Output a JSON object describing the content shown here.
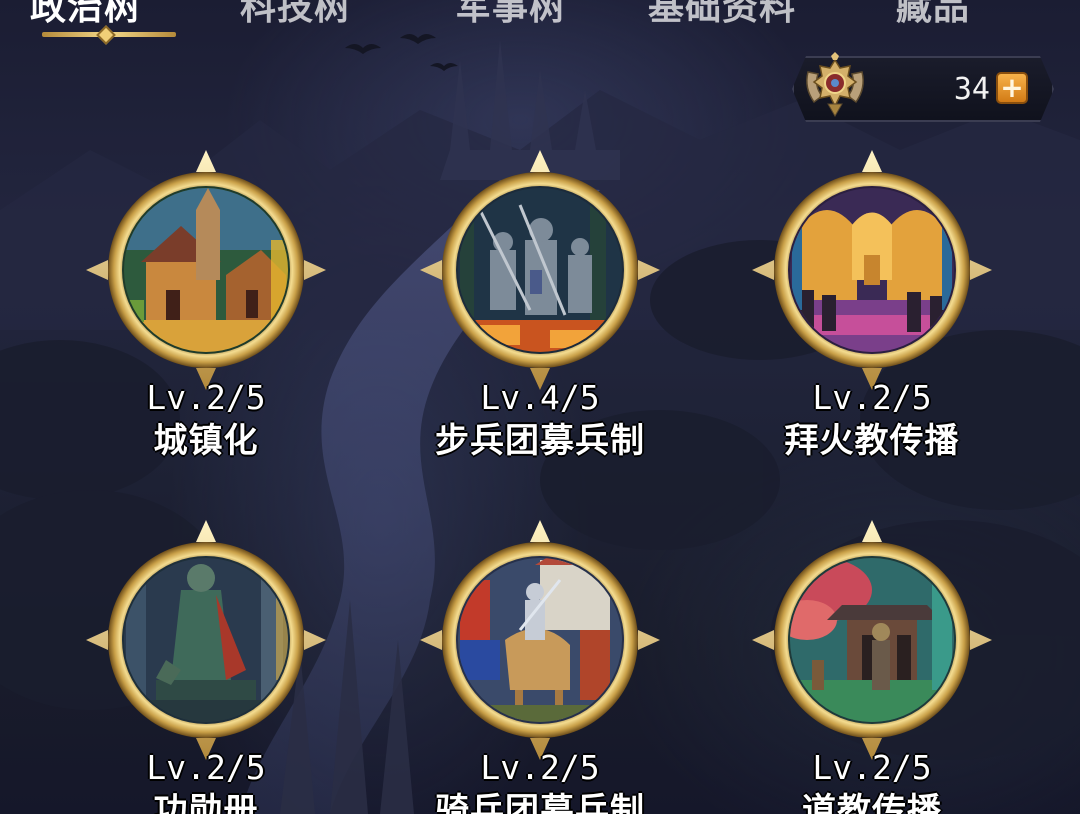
{
  "tabs": [
    {
      "label": "政治树",
      "active": true
    },
    {
      "label": "科技树",
      "active": false
    },
    {
      "label": "军事树",
      "active": false
    },
    {
      "label": "基础资料",
      "active": false
    },
    {
      "label": "藏品",
      "active": false
    }
  ],
  "currency": {
    "icon": "winged-shield-emblem-icon",
    "value": "34",
    "add_label": "+"
  },
  "policies": [
    {
      "level": "Lv.2/5",
      "name": "城镇化",
      "icon": "town-painting-icon"
    },
    {
      "level": "Lv.4/5",
      "name": "步兵团募兵制",
      "icon": "infantry-painting-icon"
    },
    {
      "level": "Lv.2/5",
      "name": "拜火教传播",
      "icon": "fire-temple-painting-icon"
    },
    {
      "level": "Lv.2/5",
      "name": "功勋册",
      "icon": "statue-painting-icon"
    },
    {
      "level": "Lv.2/5",
      "name": "骑兵团募兵制",
      "icon": "cavalry-painting-icon"
    },
    {
      "level": "Lv.2/5",
      "name": "道教传播",
      "icon": "taoist-shrine-painting-icon"
    }
  ],
  "colors": {
    "frame_gold": "#e9c56a",
    "accent_orange": "#f0a43a",
    "background": "#1e2236"
  }
}
